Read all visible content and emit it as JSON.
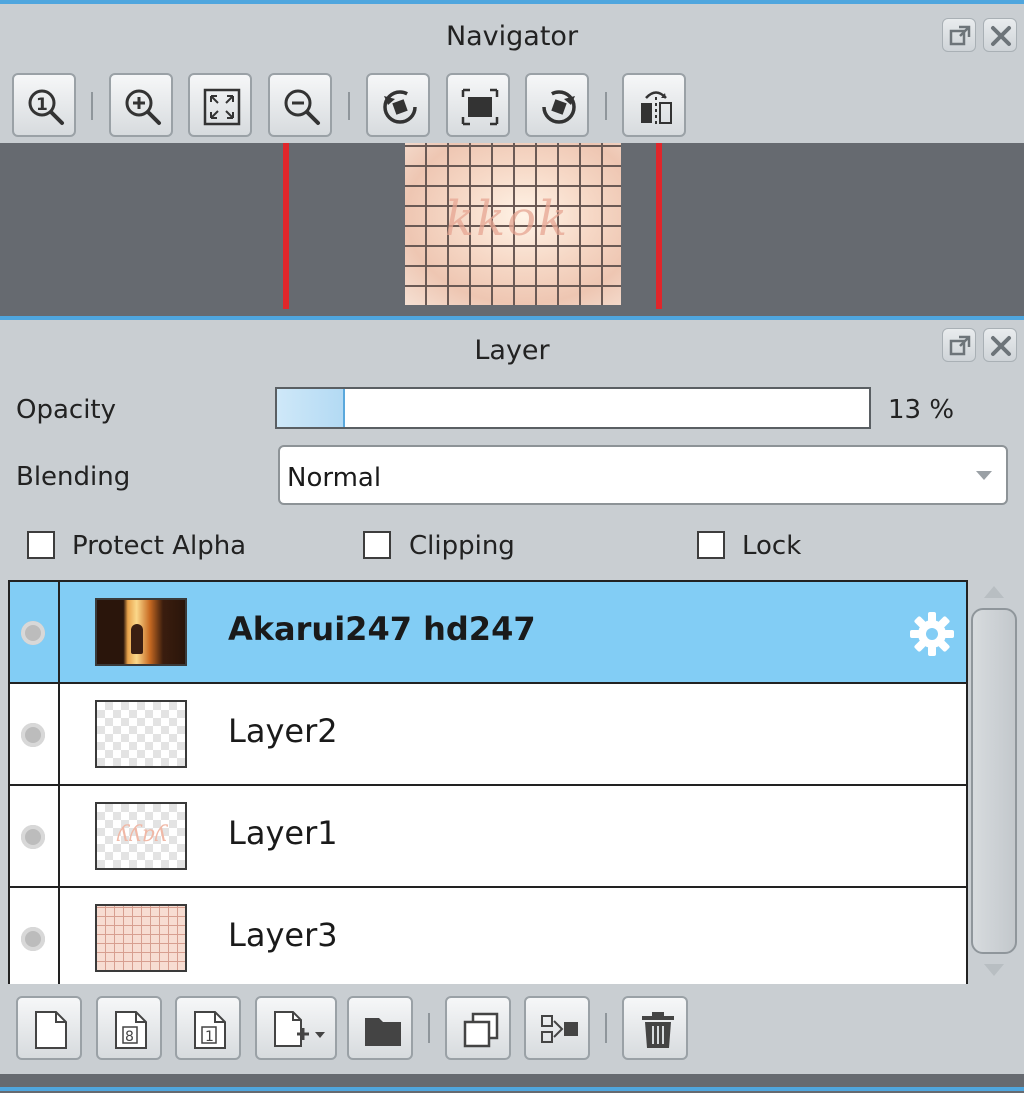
{
  "navigator": {
    "title": "Navigator",
    "preview_text": "kkok",
    "toolbar": [
      {
        "icon": "zoom-actual-size-icon",
        "label": "Actual size"
      },
      {
        "icon": "zoom-in-icon",
        "label": "Zoom in"
      },
      {
        "icon": "fit-to-window-icon",
        "label": "Fit"
      },
      {
        "icon": "zoom-out-icon",
        "label": "Zoom out"
      },
      {
        "icon": "rotate-left-icon",
        "label": "Rotate left"
      },
      {
        "icon": "reset-rotation-icon",
        "label": "Reset"
      },
      {
        "icon": "rotate-right-icon",
        "label": "Rotate right"
      },
      {
        "icon": "flip-horizontal-icon",
        "label": "Flip"
      }
    ]
  },
  "layer_panel": {
    "title": "Layer",
    "opacity_label": "Opacity",
    "opacity_value": 13,
    "opacity_text": "13 %",
    "blending_label": "Blending",
    "blending_value": "Normal",
    "checkboxes": {
      "protect_alpha": "Protect Alpha",
      "clipping": "Clipping",
      "lock": "Lock"
    },
    "layers": [
      {
        "name": "Akarui247   hd247",
        "selected": true,
        "thumb": "photo"
      },
      {
        "name": "Layer2",
        "selected": false,
        "thumb": "empty"
      },
      {
        "name": "Layer1",
        "selected": false,
        "thumb": "text"
      },
      {
        "name": "Layer3",
        "selected": false,
        "thumb": "grid"
      }
    ],
    "bottom_toolbar": [
      "new-layer-icon",
      "new-8bit-layer-icon",
      "new-1bit-layer-icon",
      "add-layer-menu-icon",
      "new-folder-icon",
      "duplicate-layer-icon",
      "merge-down-icon",
      "delete-layer-icon"
    ]
  },
  "colors": {
    "accent": "#4fa6de",
    "selected_row": "#82cdf5",
    "panel_bg": "#c9ced2",
    "guide_red": "#e0262b"
  }
}
